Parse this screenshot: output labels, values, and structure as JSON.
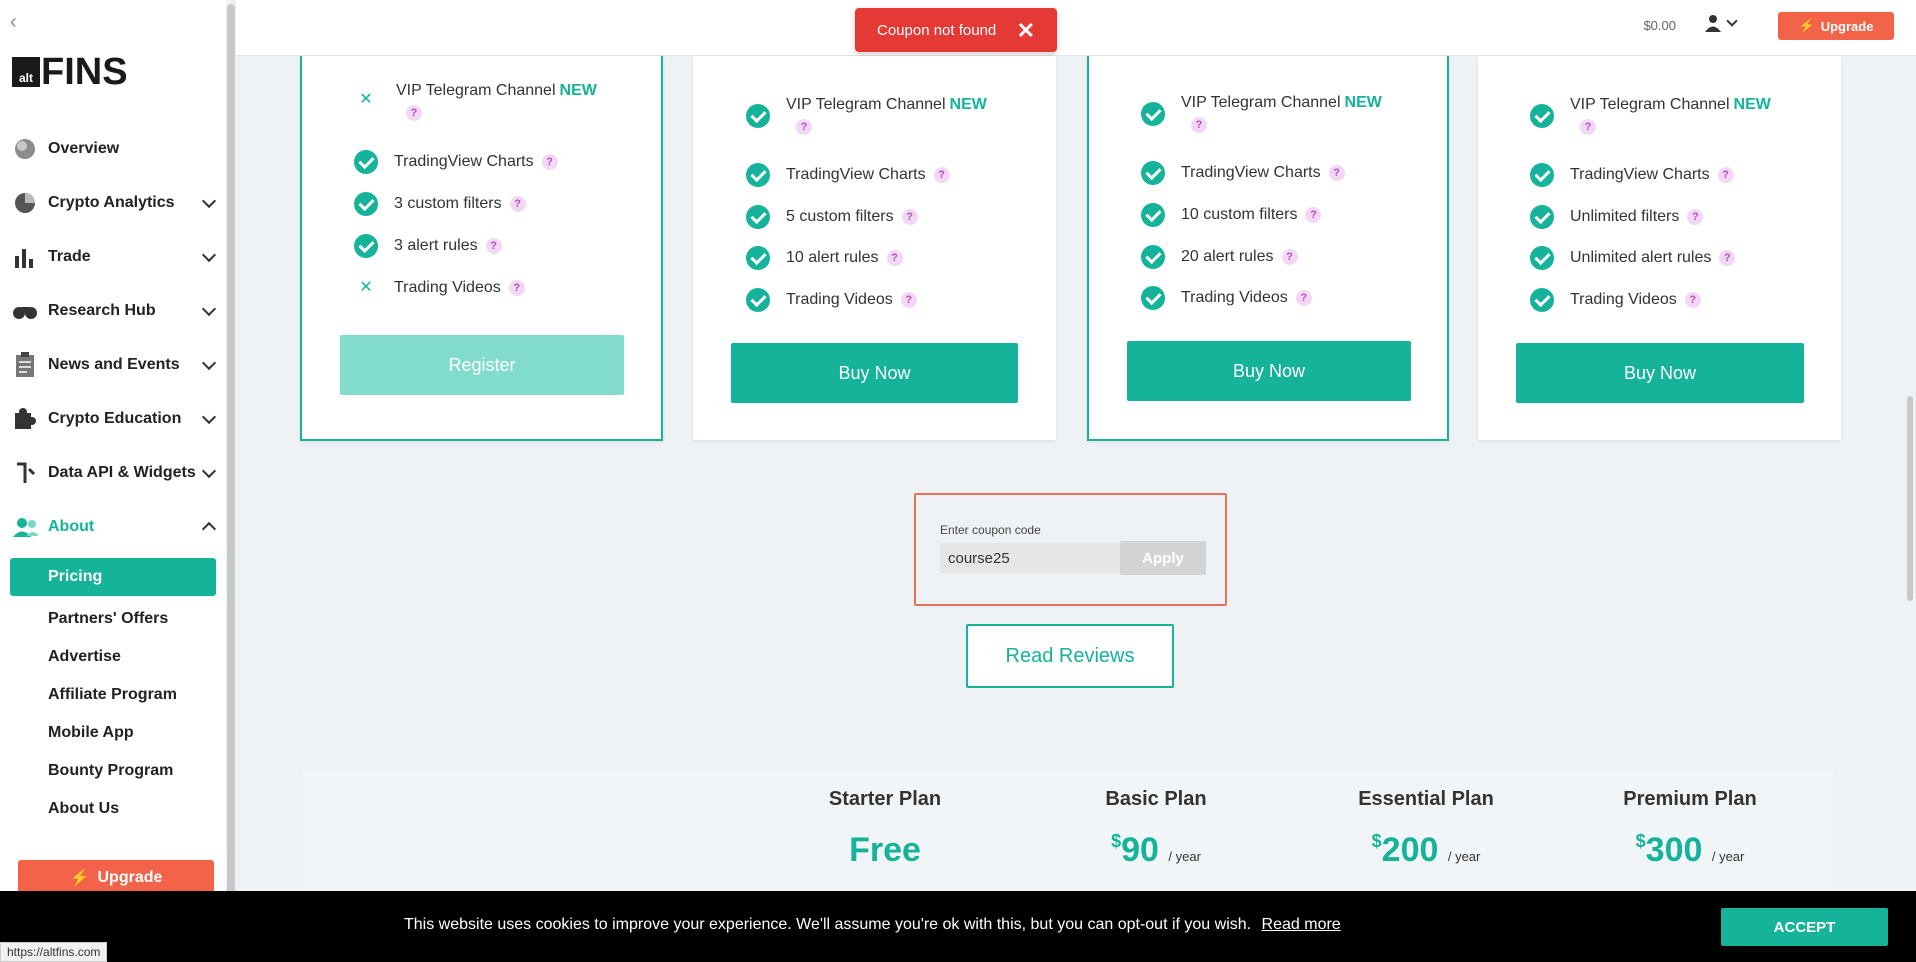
{
  "sidebar": {
    "logo_small": "alt",
    "logo_big": "FINS",
    "items": [
      {
        "label": "Overview"
      },
      {
        "label": "Crypto Analytics"
      },
      {
        "label": "Trade"
      },
      {
        "label": "Research Hub"
      },
      {
        "label": "News and Events"
      },
      {
        "label": "Crypto Education"
      },
      {
        "label": "Data API & Widgets"
      },
      {
        "label": "About"
      }
    ],
    "about_sub": [
      {
        "label": "Pricing"
      },
      {
        "label": "Partners' Offers"
      },
      {
        "label": "Advertise"
      },
      {
        "label": "Affiliate Program"
      },
      {
        "label": "Mobile App"
      },
      {
        "label": "Bounty Program"
      },
      {
        "label": "About Us"
      }
    ],
    "upgrade": "Upgrade"
  },
  "topbar": {
    "balance": "$0.00",
    "upgrade": "Upgrade"
  },
  "toast": {
    "message": "Coupon not found",
    "close": "✕"
  },
  "cards": [
    {
      "vip": "VIP Telegram Channel",
      "new": "NEW",
      "charts": "TradingView Charts",
      "filters": "3 custom filters",
      "alerts": "3 alert rules",
      "videos": "Trading Videos",
      "button": "Register"
    },
    {
      "vip": "VIP Telegram Channel",
      "new": "NEW",
      "charts": "TradingView Charts",
      "filters": "5 custom filters",
      "alerts": "10 alert rules",
      "videos": "Trading Videos",
      "button": "Buy Now"
    },
    {
      "vip": "VIP Telegram Channel",
      "new": "NEW",
      "charts": "TradingView Charts",
      "filters": "10 custom filters",
      "alerts": "20 alert rules",
      "videos": "Trading Videos",
      "button": "Buy Now"
    },
    {
      "vip": "VIP Telegram Channel",
      "new": "NEW",
      "charts": "TradingView Charts",
      "filters": "Unlimited filters",
      "alerts": "Unlimited alert rules",
      "videos": "Trading Videos",
      "button": "Buy Now"
    }
  ],
  "coupon": {
    "label": "Enter coupon code",
    "value": "course25",
    "apply": "Apply"
  },
  "reviews": "Read Reviews",
  "plans": [
    {
      "name": "Starter Plan",
      "price": "Free"
    },
    {
      "name": "Basic Plan",
      "currency": "$",
      "price": "90",
      "per": "/ year"
    },
    {
      "name": "Essential Plan",
      "currency": "$",
      "price": "200",
      "per": "/ year"
    },
    {
      "name": "Premium Plan",
      "currency": "$",
      "price": "300",
      "per": "/ year"
    }
  ],
  "cookie": {
    "message": "This website uses cookies to improve your experience. We'll assume you're ok with this, but you can opt-out if you wish.",
    "read_more": "Read more",
    "accept": "ACCEPT"
  },
  "status_url": "https://altfins.com",
  "colors": {
    "accent": "#14b39a",
    "upgrade": "#f2634a",
    "error": "#e53935"
  }
}
